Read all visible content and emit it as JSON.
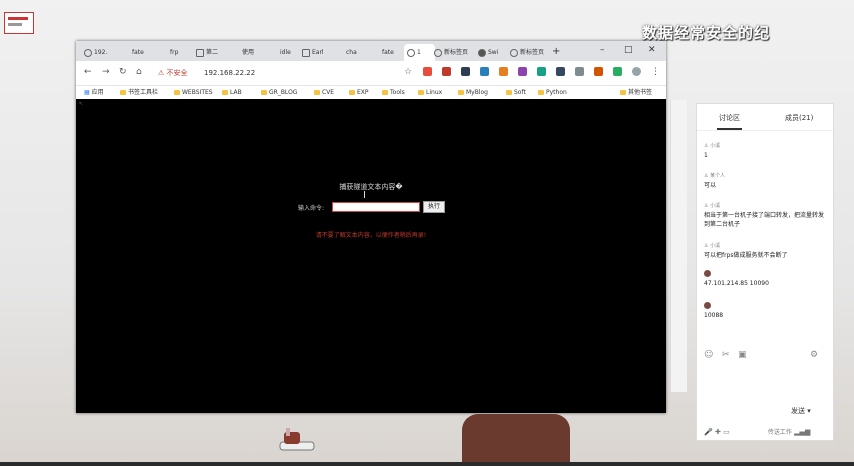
{
  "desktop": {
    "icon_label": "",
    "watermark": "数据经常安全的纪"
  },
  "browser": {
    "tabs": [
      {
        "label": "192."
      },
      {
        "label": "fate"
      },
      {
        "label": "frp"
      },
      {
        "label": "第二"
      },
      {
        "label": "使用"
      },
      {
        "label": "idle"
      },
      {
        "label": "Earl"
      },
      {
        "label": "cha"
      },
      {
        "label": "fate"
      },
      {
        "label": "1"
      },
      {
        "label": "新标签页"
      },
      {
        "label": "Swi"
      },
      {
        "label": "新标签页"
      }
    ],
    "new_tab": "+",
    "address": {
      "warning": "不安全",
      "url": "192.168.22.22"
    },
    "bookmarks": [
      "应用",
      "书签工具栏",
      "WEBSITES",
      "LAB",
      "GR_BLOG",
      "CVE",
      "EXP",
      "Tools",
      "Linux",
      "MyBlog",
      "Soft",
      "Python",
      "其他书签"
    ],
    "page": {
      "title": "捕获隧道文本内容�",
      "input_label": "输入命令:",
      "input_value": "",
      "submit_label": "执行",
      "hint": "请不要了解文本内容，以便作者稍后再录!"
    }
  },
  "chat": {
    "tabs": [
      "讨论区",
      "成员(21)"
    ],
    "messages": [
      {
        "user": "小溪",
        "text": "1"
      },
      {
        "user": "某个人",
        "text": "可以"
      },
      {
        "user": "小溪",
        "text": "相当于第一台机子接了端口转发，把流量转发到第二台机子"
      },
      {
        "user": "小溪",
        "text": "可以把frps做成服务就不会断了"
      },
      {
        "user": "",
        "text": "47.101.214.85 10090"
      },
      {
        "user": "",
        "text": "10088"
      }
    ],
    "send_label": "发送",
    "bottom_text": "传送工作"
  },
  "colors": {
    "accent_warning": "#c0392b",
    "page_bg": "#000000",
    "tab_strip": "#dfe1e5"
  }
}
